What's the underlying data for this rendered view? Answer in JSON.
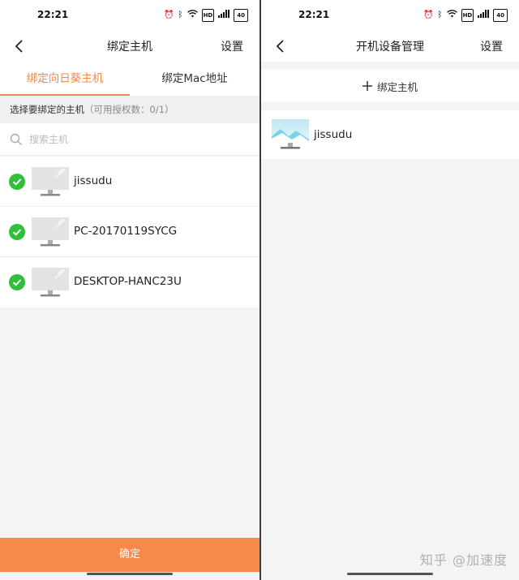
{
  "left": {
    "status": {
      "time": "22:21",
      "battery": "40",
      "hd": "HD"
    },
    "nav": {
      "title": "绑定主机",
      "action": "设置"
    },
    "tabs": [
      {
        "label": "绑定向日葵主机",
        "active": true
      },
      {
        "label": "绑定Mac地址",
        "active": false
      }
    ],
    "hint": {
      "text": "选择要绑定的主机",
      "license": "（可用授权数：0/1）"
    },
    "search": {
      "placeholder": "搜索主机"
    },
    "hosts": [
      {
        "name": "jissudu",
        "checked": true
      },
      {
        "name": "PC-20170119SYCG",
        "checked": true
      },
      {
        "name": "DESKTOP-HANC23U",
        "checked": true
      }
    ],
    "confirm_label": "确定"
  },
  "right": {
    "status": {
      "time": "22:21",
      "battery": "40",
      "hd": "HD"
    },
    "nav": {
      "title": "开机设备管理",
      "action": "设置"
    },
    "bind_host_label": "绑定主机",
    "devices": [
      {
        "name": "jissudu"
      }
    ]
  },
  "watermark": "知乎 @加速度",
  "colors": {
    "accent": "#f7894d",
    "check": "#2fbf3a",
    "tab_active": "#ef8a4c"
  },
  "icons": [
    "back-icon",
    "search-icon",
    "check-icon",
    "monitor-icon",
    "plus-icon",
    "wifi-icon",
    "bluetooth-icon",
    "alarm-icon",
    "signal-icon",
    "battery-icon"
  ]
}
